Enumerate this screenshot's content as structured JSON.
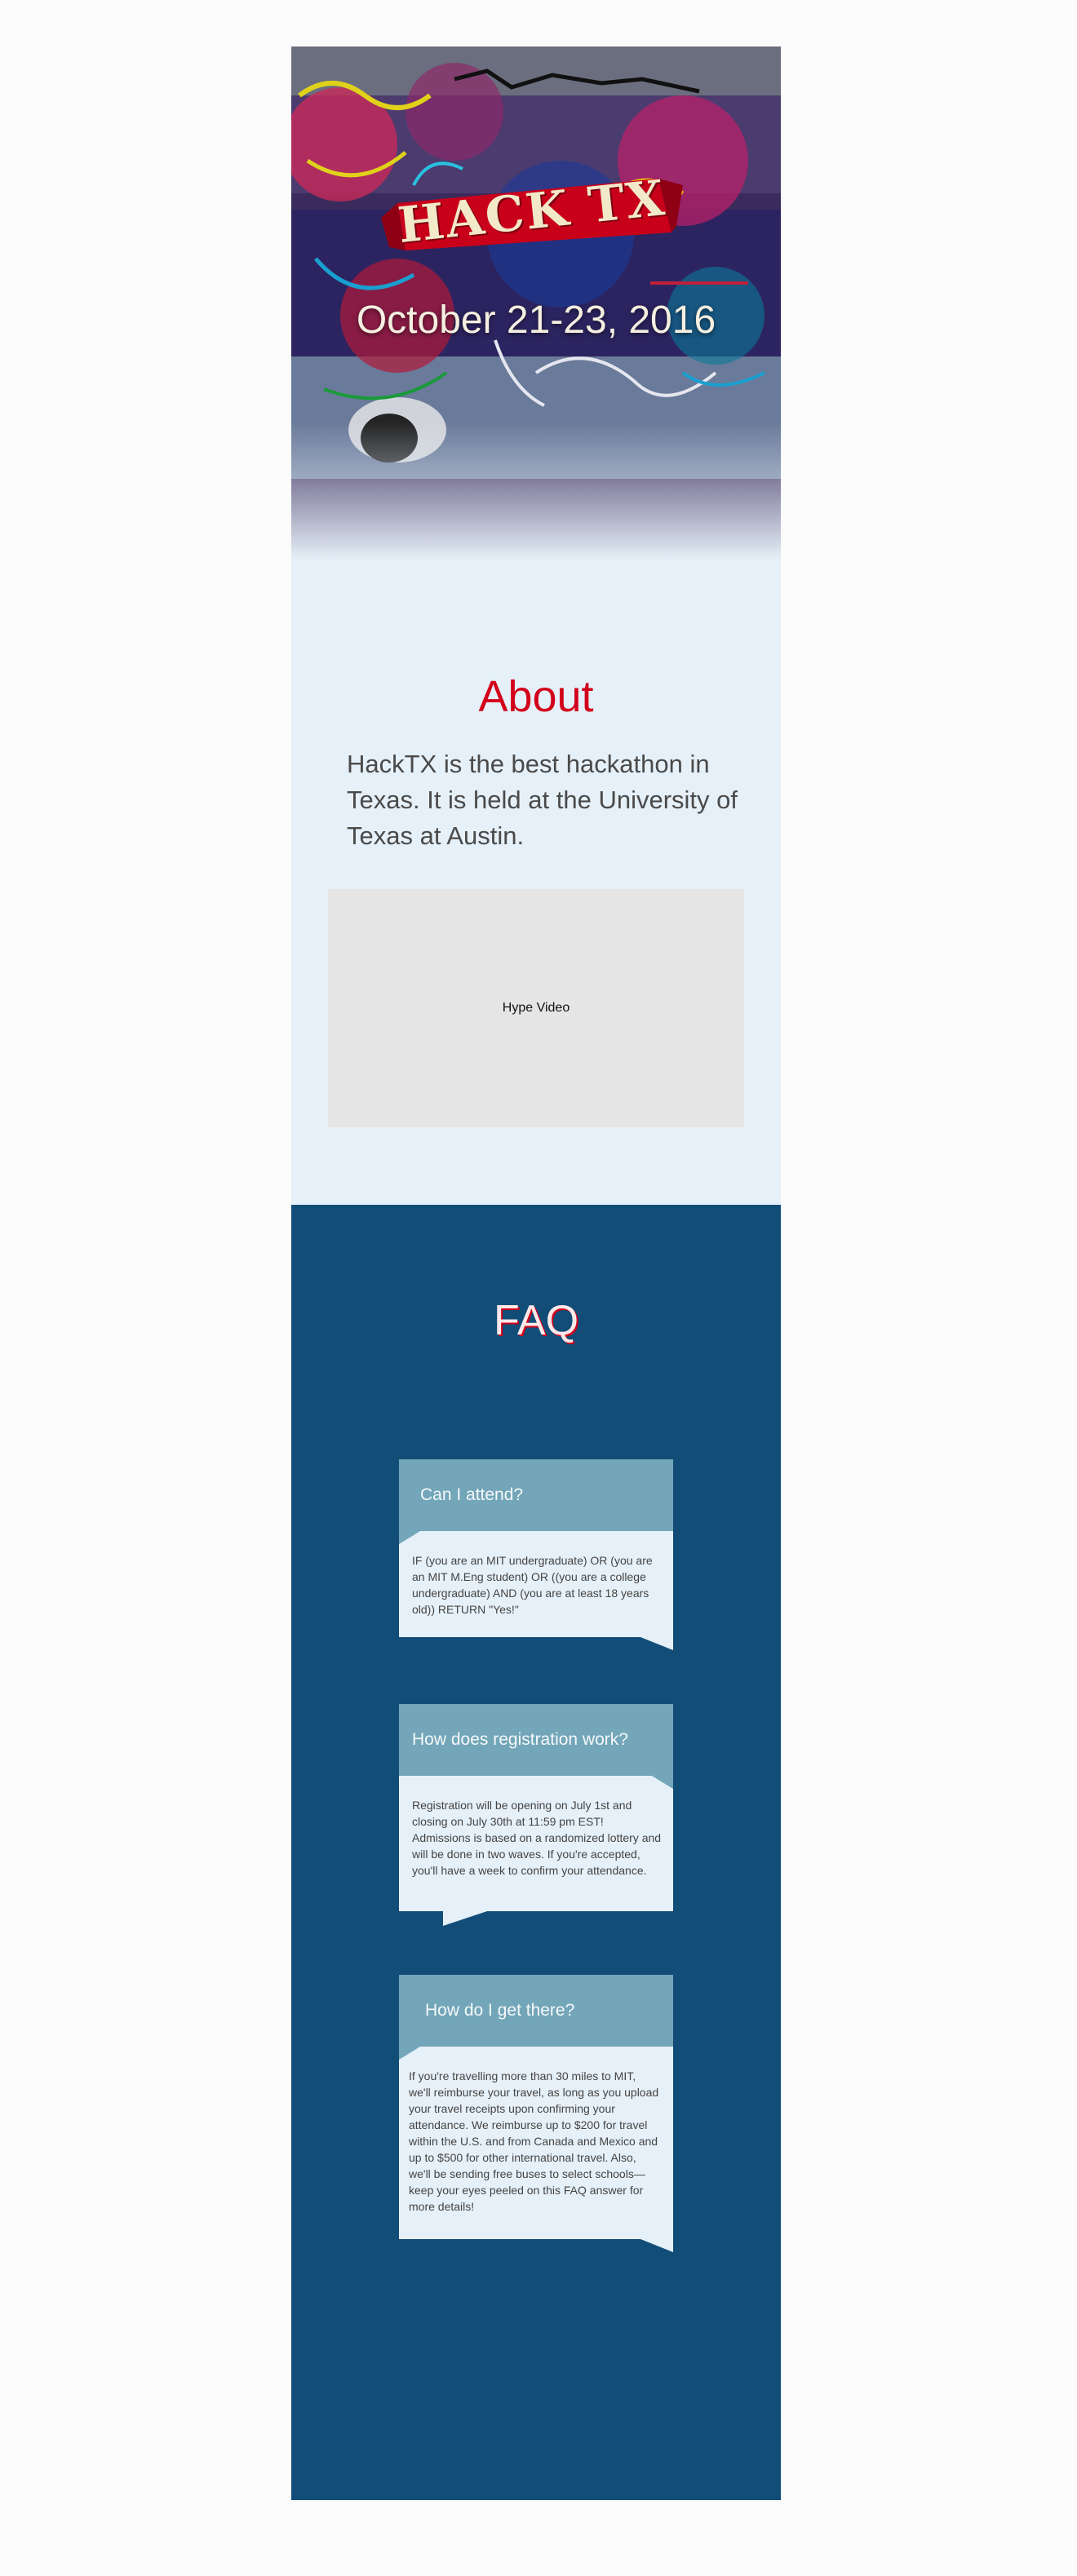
{
  "hero": {
    "logo_text": "HACK TX",
    "date": "October 21-23, 2016",
    "colors": {
      "brand_red": "#d2001a",
      "cream": "#f2e9c9"
    }
  },
  "about": {
    "title": "About",
    "text": "HackTX is the best hackathon in Texas. It is held at the University of Texas at Austin.",
    "video_label": "Hype Video"
  },
  "faq": {
    "title": "FAQ",
    "items": [
      {
        "question": "Can I attend?",
        "answer": "IF (you are an MIT undergraduate) OR (you are an MIT M.Eng student) OR ((you are a college undergraduate) AND (you are at least 18 years old)) RETURN \"Yes!\""
      },
      {
        "question": "How does registration work?",
        "answer": "Registration will be opening on July 1st and closing on July 30th at 11:59 pm EST! Admissions is based on a randomized lottery and will be done in two waves. If you're accepted, you'll have a week to confirm your attendance."
      },
      {
        "question": "How do I get there?",
        "answer": "If you're travelling more than 30 miles to MIT, we'll reimburse your travel, as long as you upload your travel receipts upon confirming your attendance. We reimburse up to $200 for travel within the U.S. and from Canada and Mexico and up to $500 for other international travel. Also, we'll be sending free buses to select schools—keep your eyes peeled on this FAQ answer for more details!"
      }
    ]
  }
}
